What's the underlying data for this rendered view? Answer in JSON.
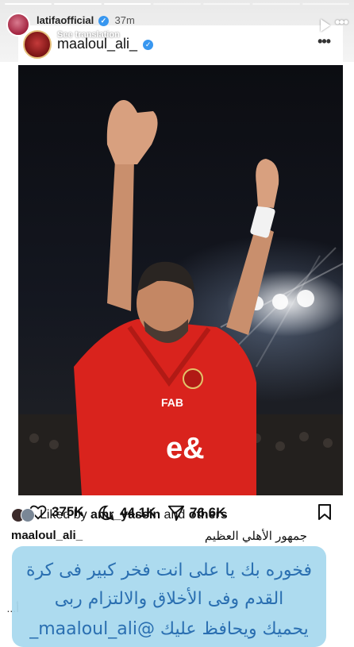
{
  "story": {
    "username": "latifaofficial",
    "time": "37m",
    "translation_label": "See translation",
    "more_label": "•••"
  },
  "post": {
    "username": "maaloul_ali_",
    "more_label": "•••",
    "likes": "375K",
    "comments": "44.1K",
    "shares": "76.6K",
    "liked_by_prefix": "Liked by ",
    "liked_by_user": "amr_yassin",
    "liked_by_and": " and ",
    "liked_by_others": "others",
    "caption_user": "maaloul_ali_",
    "caption_text": "جمهور الأهلي العظيم",
    "caption_overflow": "أ..."
  },
  "sticker": {
    "line1": "فخوره بك يا على انت فخر كبير فى كرة",
    "line2": "القدم وفى الأخلاق والالتزام ربى",
    "line3": "يحميك ويحافظ عليك @maaloul_ali_"
  },
  "colors": {
    "sticker_bg": "#a7d8ee",
    "sticker_text": "#2a6fb1",
    "verified": "#3897f0",
    "jersey": "#d9231d"
  }
}
